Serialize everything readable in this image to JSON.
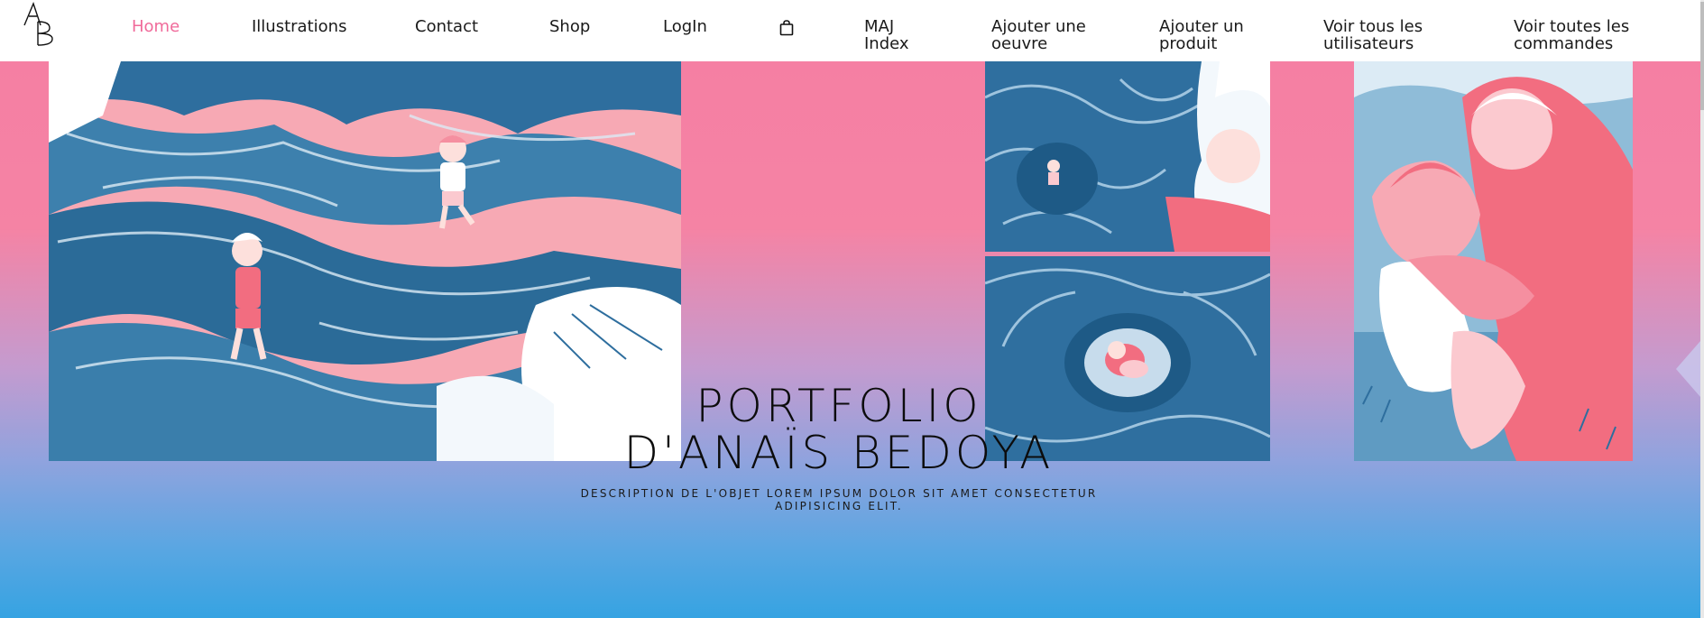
{
  "nav": {
    "logo_text": "AB",
    "items": [
      {
        "label": "Home"
      },
      {
        "label": "Illustrations"
      },
      {
        "label": "Contact"
      },
      {
        "label": "Shop"
      },
      {
        "label": "LogIn"
      },
      {
        "label": "MAJ Index"
      },
      {
        "label": "Ajouter une oeuvre"
      },
      {
        "label": "Ajouter un produit"
      },
      {
        "label": "Voir tous les utilisateurs"
      },
      {
        "label": "Voir toutes les commandes"
      }
    ],
    "cart_icon": "shopping-bag-icon"
  },
  "hero": {
    "title": "PORTFOLIO\nD'ANAÏS BEDOYA",
    "description": "DESCRIPTION DE L'OBJET LOREM IPSUM DOLOR SIT AMET CONSECTETUR ADIPISICING ELIT.",
    "next_icon": "chevron-left-icon"
  },
  "colors": {
    "accent": "#f06a9a",
    "gradient_top": "#f57fa3",
    "gradient_bottom": "#36a3e2",
    "illustration_blue": "#2f6f9f",
    "illustration_pink": "#f26d80"
  }
}
